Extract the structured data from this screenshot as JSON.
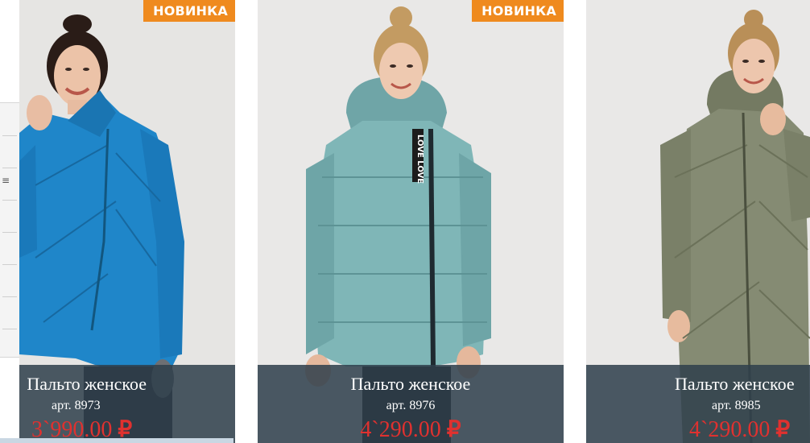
{
  "products": [
    {
      "badge": "НОВИНКА",
      "title": "Пальто женское",
      "sku": "арт. 8973",
      "price_value": "3`990.00",
      "currency": "₽",
      "color": "#1f86c9"
    },
    {
      "badge": "НОВИНКА",
      "title": "Пальто женское",
      "sku": "арт. 8976",
      "price_value": "4`290.00",
      "currency": "₽",
      "color": "#7fb6b7",
      "print_text": "LOVE LOVE"
    },
    {
      "badge": "",
      "title": "Пальто женское",
      "sku": "арт. 8985",
      "price_value": "4`290.00",
      "currency": "₽",
      "color": "#858b73"
    }
  ],
  "colors": {
    "badge": "#ef8a1e",
    "price": "#e0312f",
    "info_panel": "#2e3f4c"
  }
}
